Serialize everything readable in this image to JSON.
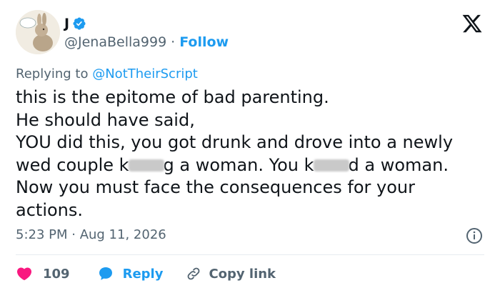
{
  "author": {
    "name": "J",
    "handle": "@JenaBella999",
    "separator": "·",
    "follow_label": "Follow",
    "verified": true
  },
  "reply_context": {
    "prefix": "Replying to",
    "mention": "@NotTheirScript"
  },
  "tweet": {
    "line1": "this is the epitome of bad parenting.",
    "line2": "He should have said,",
    "line3": "YOU did this, you got drunk and drove into a newly",
    "line4a": "wed couple k",
    "line4b": "g a woman. You k",
    "line4c": "d a woman.",
    "line5": "Now you must face the consequences for your",
    "line6": "actions."
  },
  "meta": {
    "timestamp": "5:23 PM · Aug 11, 2026"
  },
  "actions": {
    "like_count": "109",
    "reply_label": "Reply",
    "copy_label": "Copy link"
  },
  "colors": {
    "accent": "#1d9bf0",
    "like": "#f91880",
    "muted": "#536471",
    "text": "#0f1419"
  },
  "icons": {
    "avatar": "rabbit-avatar",
    "verified": "verified-badge-icon",
    "brand": "x-logo-icon",
    "info": "info-icon",
    "like": "heart-icon",
    "reply": "speech-bubble-icon",
    "copy": "link-icon"
  }
}
